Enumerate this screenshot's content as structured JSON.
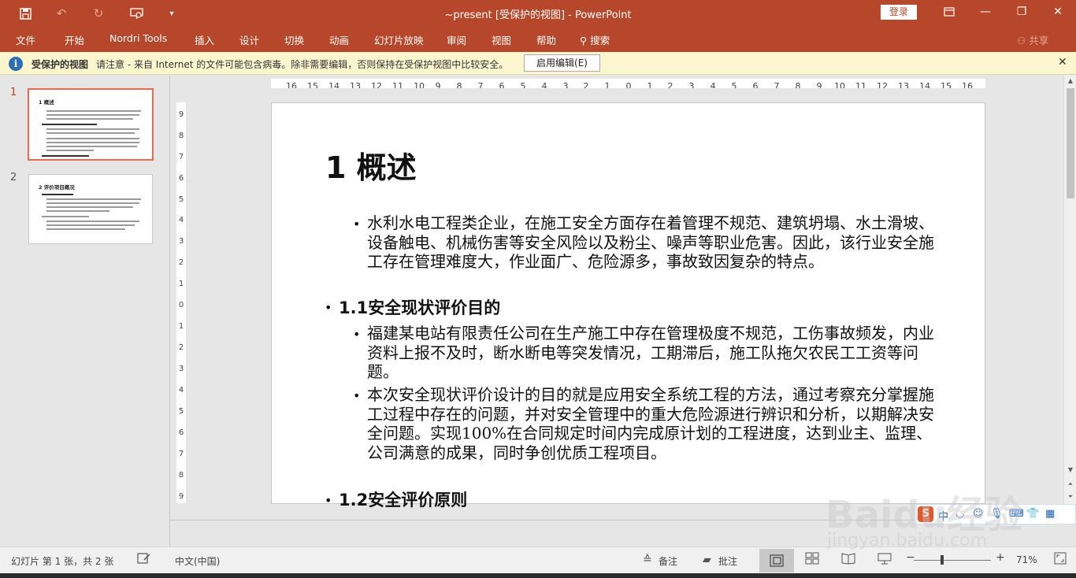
{
  "titlebar": {
    "title": "~present [受保护的视图] - PowerPoint",
    "login_label": "登录"
  },
  "menu": {
    "items": [
      "文件",
      "开始",
      "Nordri Tools",
      "插入",
      "设计",
      "切换",
      "动画",
      "幻灯片放映",
      "审阅",
      "视图",
      "帮助",
      "搜索"
    ],
    "share_label": "共享"
  },
  "infobar": {
    "title": "受保护的视图",
    "message": "请注意 - 来自 Internet 的文件可能包含病毒。除非需要编辑，否则保持在受保护视图中比较安全。",
    "enable_button": "启用编辑(E)"
  },
  "thumbnails": [
    {
      "number": "1",
      "title": "1 概述"
    },
    {
      "number": "2",
      "title": "2 评价项目概况"
    }
  ],
  "slide": {
    "title": "1 概述",
    "blocks": [
      {
        "level": 2,
        "text": "水利水电工程类企业，在施工安全方面存在着管理不规范、建筑坍塌、水土滑坡、设备触电、机械伤害等安全风险以及粉尘、噪声等职业危害。因此，该行业安全施工存在管理难度大，作业面广、危险源多，事故致因复杂的特点。"
      },
      {
        "level": 1,
        "text": "1.1安全现状评价目的"
      },
      {
        "level": 2,
        "text": "福建某电站有限责任公司在生产施工中存在管理极度不规范，工伤事故频发，内业资料上报不及时，断水断电等突发情况，工期滞后，施工队拖欠农民工工资等问题。"
      },
      {
        "level": 2,
        "text": "本次安全现状评价设计的目的就是应用安全系统工程的方法，通过考察充分掌握施工过程中存在的问题，并对安全管理中的重大危险源进行辨识和分析，以期解决安全问题。实现100%在合同规定时间内完成原计划的工程进度，达到业主、监理、公司满意的成果，同时争创优质工程项目。"
      },
      {
        "level": 1,
        "text": "1.2安全评价原则"
      }
    ]
  },
  "statusbar": {
    "slide_info": "幻灯片 第 1 张，共 2 张",
    "language": "中文(中国)",
    "notes_label": "备注",
    "comments_label": "批注",
    "zoom": "71%"
  },
  "ime": {
    "label": "中"
  },
  "watermark": {
    "brand": "Baidu经验",
    "url": "jingyan.baidu.com"
  },
  "colors": {
    "accent": "#b7472a",
    "infobar_bg": "#fcf6cf",
    "selection": "#e96c4f"
  }
}
